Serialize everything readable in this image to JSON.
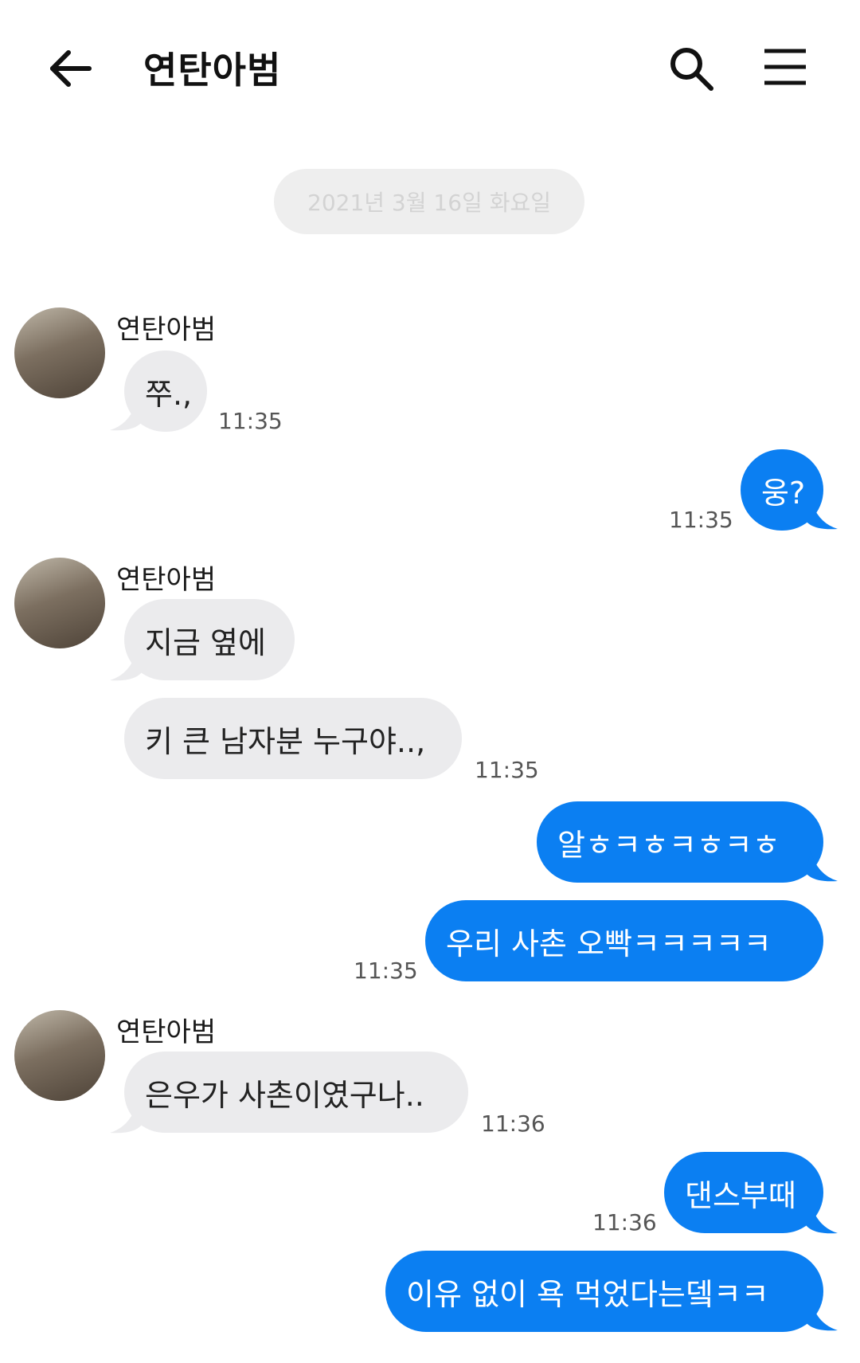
{
  "header": {
    "title": "연탄아범",
    "back_icon": "arrow-left-icon",
    "search_icon": "search-icon",
    "menu_icon": "hamburger-menu-icon"
  },
  "date_separator": "2021년 3월 16일 화요일",
  "colors": {
    "outgoing": "#0b7ff2",
    "incoming": "#ebebed",
    "date_pill": "#eeeeee"
  },
  "messages": {
    "g1": {
      "sender": "연탄아범",
      "m1": "쭈.,",
      "time": "11:35"
    },
    "o1": {
      "m1": "웅?",
      "time": "11:35"
    },
    "g2": {
      "sender": "연탄아범",
      "m1": "지금 옆에",
      "m2": "키 큰 남자분 누구야..,",
      "time": "11:35"
    },
    "o2": {
      "m1": "알ㅎㅋㅎㅋㅎㅋㅎ",
      "m2": "우리 사촌 오빡ㅋㅋㅋㅋㅋ",
      "time": "11:35"
    },
    "g3": {
      "sender": "연탄아범",
      "m1": "은우가 사촌이였구나..",
      "time": "11:36"
    },
    "o3": {
      "m1": "댄스부때",
      "m2": "이유 없이 욕 먹었다는뎈ㅋㅋ",
      "time": "11:36"
    }
  }
}
